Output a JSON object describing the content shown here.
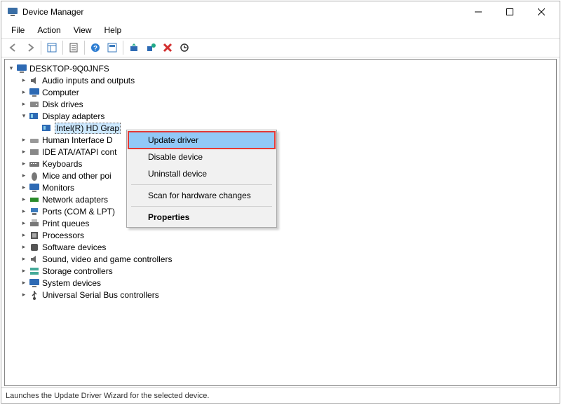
{
  "title": "Device Manager",
  "menubar": {
    "file": "File",
    "action": "Action",
    "view": "View",
    "help": "Help"
  },
  "tree": {
    "root": "DESKTOP-9Q0JNFS",
    "items": {
      "audio": "Audio inputs and outputs",
      "computer": "Computer",
      "disk": "Disk drives",
      "display": "Display adapters",
      "intelhd": "Intel(R) HD Grap",
      "hid": "Human Interface D",
      "ide": "IDE ATA/ATAPI cont",
      "keyboards": "Keyboards",
      "mice": "Mice and other poi",
      "monitors": "Monitors",
      "network": "Network adapters",
      "ports": "Ports (COM & LPT)",
      "printq": "Print queues",
      "processors": "Processors",
      "softdev": "Software devices",
      "sound": "Sound, video and game controllers",
      "storage": "Storage controllers",
      "system": "System devices",
      "usb": "Universal Serial Bus controllers"
    }
  },
  "context_menu": {
    "update_driver": "Update driver",
    "disable_device": "Disable device",
    "uninstall_device": "Uninstall device",
    "scan": "Scan for hardware changes",
    "properties": "Properties"
  },
  "status": "Launches the Update Driver Wizard for the selected device."
}
